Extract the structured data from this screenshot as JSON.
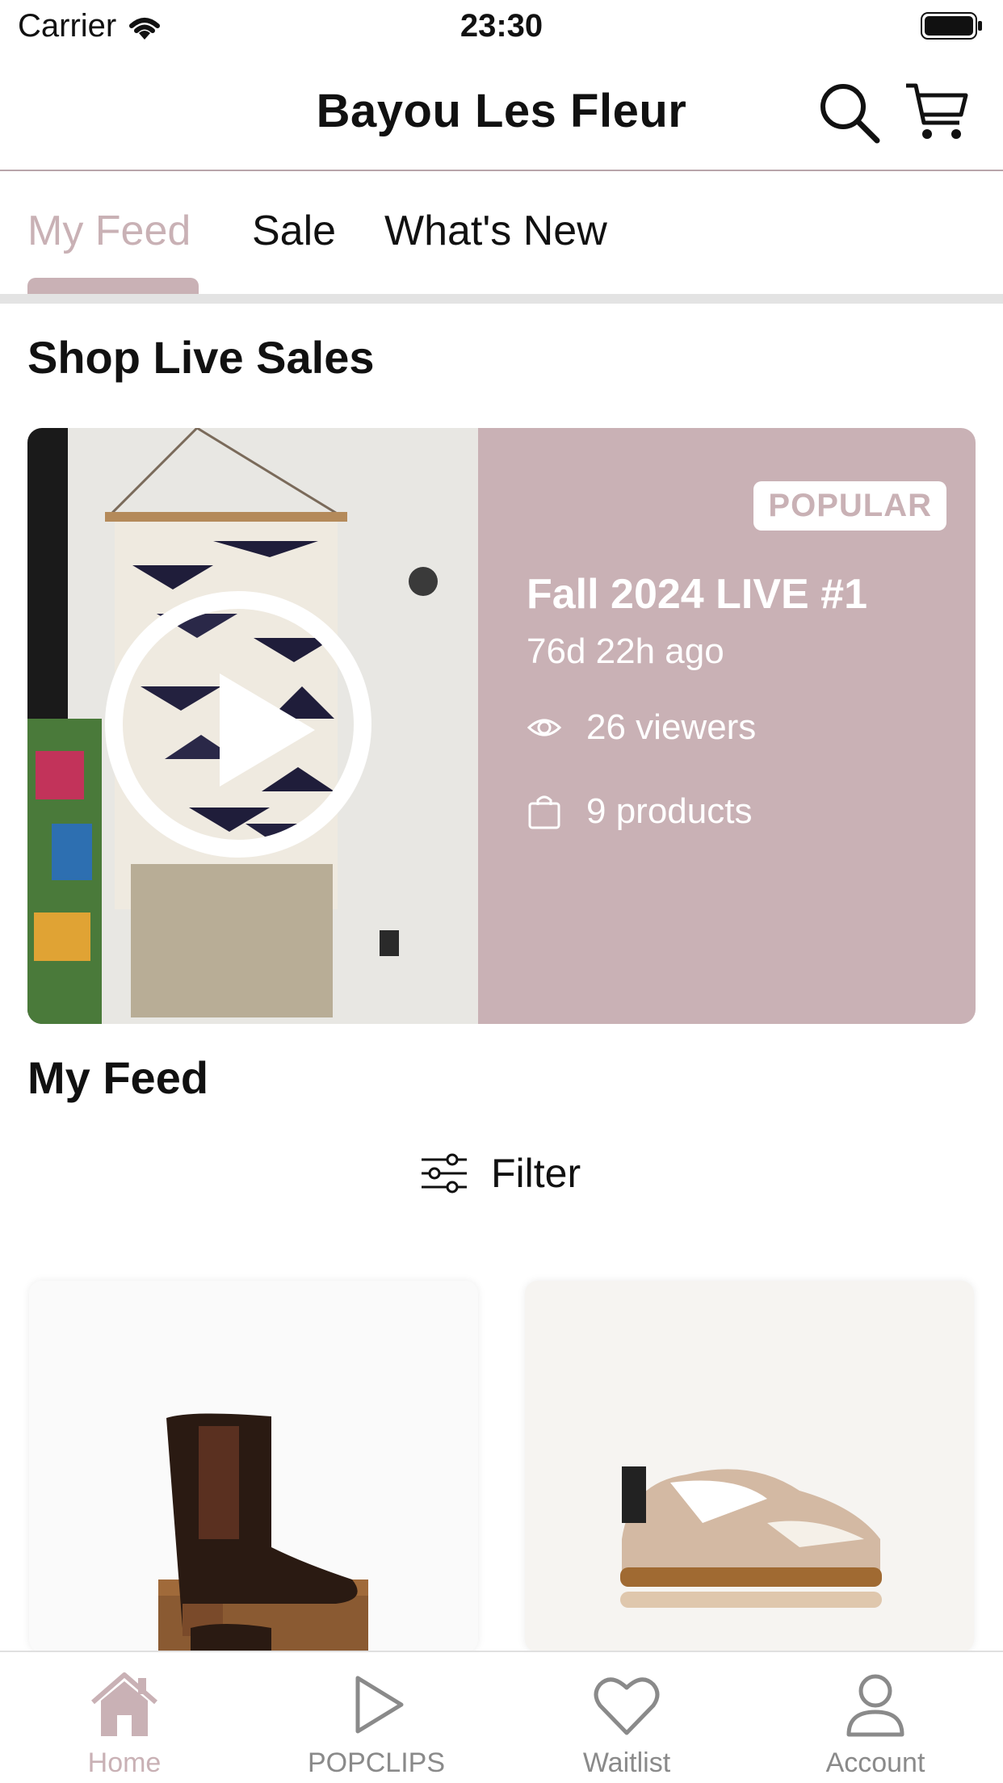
{
  "status_bar": {
    "carrier": "Carrier",
    "time": "23:30"
  },
  "header": {
    "title": "Bayou Les Fleur",
    "search_icon": "search-icon",
    "cart_icon": "cart-icon"
  },
  "tabs": [
    {
      "label": "My Feed",
      "active": true
    },
    {
      "label": "Sale",
      "active": false
    },
    {
      "label": "What's New",
      "active": false
    }
  ],
  "live_section": {
    "title": "Shop Live Sales",
    "card": {
      "badge": "POPULAR",
      "name": "Fall 2024 LIVE #1",
      "time_ago": "76d 22h ago",
      "viewers": "26 viewers",
      "products": "9 products"
    }
  },
  "feed": {
    "title": "My Feed",
    "filter_label": "Filter",
    "products": [
      {
        "image": "brown-leather-chelsea-boot"
      },
      {
        "image": "tan-and-white-sneaker"
      }
    ]
  },
  "bottom_nav": [
    {
      "label": "Home",
      "icon": "home-icon",
      "active": true
    },
    {
      "label": "POPCLIPS",
      "icon": "play-icon",
      "active": false
    },
    {
      "label": "Waitlist",
      "icon": "heart-icon",
      "active": false
    },
    {
      "label": "Account",
      "icon": "person-icon",
      "active": false
    }
  ],
  "colors": {
    "accent": "#c9b1b5",
    "nav_inactive": "#8a8a8a",
    "divider": "#e3e3e3"
  }
}
